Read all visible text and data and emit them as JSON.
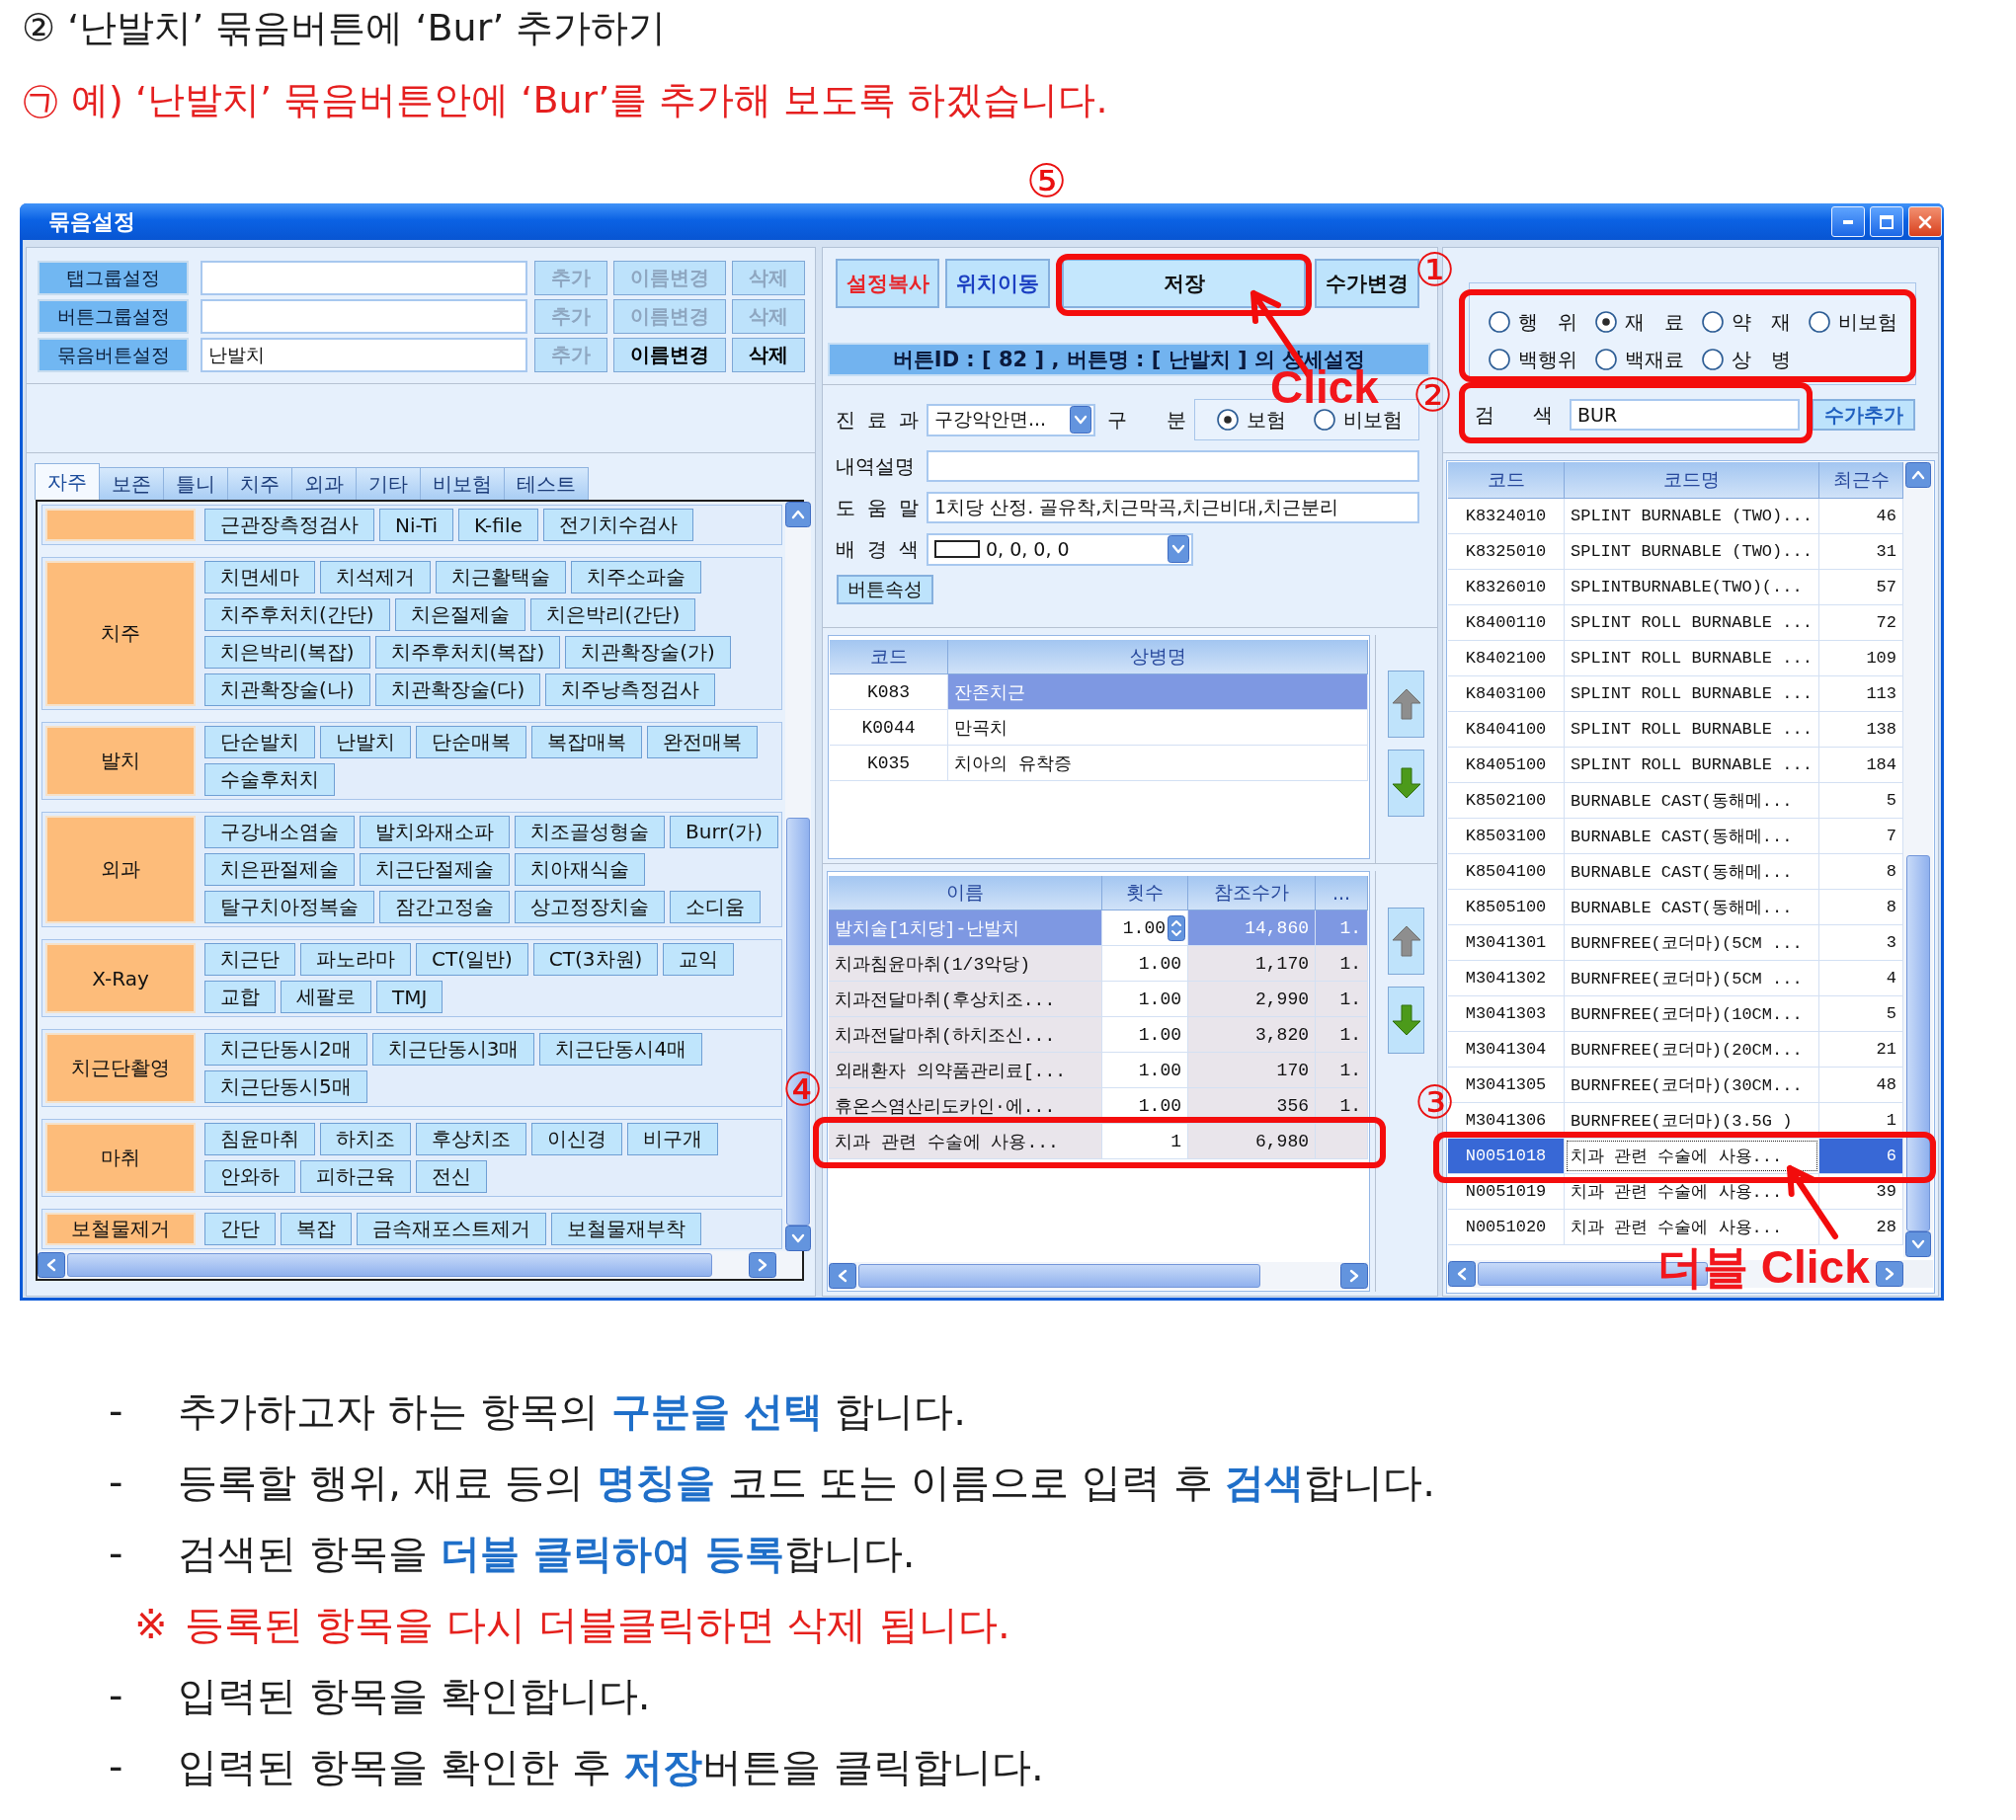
{
  "header": {
    "title": "② ‘난발치’ 묶음버튼에 ‘Bur’ 추가하기",
    "subtitle": "㉠ 예) ‘난발치’ 묶음버튼안에 ‘Bur’를 추가해 보도록 하겠습니다."
  },
  "window": {
    "title": "묶음설정"
  },
  "group_settings": [
    {
      "label": "탭그룹설정",
      "buttons": [
        {
          "label": "추가",
          "disabled": true
        },
        {
          "label": "이름변경",
          "disabled": true
        },
        {
          "label": "삭제",
          "disabled": true
        }
      ]
    },
    {
      "label": "버튼그룹설정",
      "buttons": [
        {
          "label": "추가",
          "disabled": true
        },
        {
          "label": "이름변경",
          "disabled": true
        },
        {
          "label": "삭제",
          "disabled": true
        }
      ]
    },
    {
      "label": "묶음버튼설정",
      "value": "난발치",
      "buttons": [
        {
          "label": "추가",
          "disabled": true
        },
        {
          "label": "이름변경",
          "disabled": false
        },
        {
          "label": "삭제",
          "disabled": false
        }
      ]
    }
  ],
  "tabs": [
    {
      "label": "자주",
      "selected": true
    },
    {
      "label": "보존",
      "selected": false
    },
    {
      "label": "틀니",
      "selected": false
    },
    {
      "label": "치주",
      "selected": false
    },
    {
      "label": "외과",
      "selected": false
    },
    {
      "label": "기타",
      "selected": false
    },
    {
      "label": "비보험",
      "selected": false
    },
    {
      "label": "테스트",
      "selected": false
    }
  ],
  "button_groups": [
    {
      "button_rows": [
        [
          "근관장측정검사",
          "Ni-Ti",
          "K-file",
          "전기치수검사"
        ]
      ]
    },
    {
      "label": "치주",
      "button_rows": [
        [
          "치면세마",
          "치석제거",
          "치근활택술",
          "치주소파술"
        ],
        [
          "치주후처치(간단)",
          "치은절제술",
          "치은박리(간단)"
        ],
        [
          "치은박리(복잡)",
          "치주후처치(복잡)",
          "치관확장술(가)"
        ],
        [
          "치관확장술(나)",
          "치관확장술(다)",
          "치주낭측정검사"
        ]
      ]
    },
    {
      "label": "발치",
      "button_rows": [
        [
          "단순발치",
          "난발치",
          "단순매복",
          "복잡매복",
          "완전매복"
        ],
        [
          "수술후처치"
        ]
      ]
    },
    {
      "label": "외과",
      "button_rows": [
        [
          "구강내소염술",
          "발치와재소파",
          "치조골성형술",
          "Burr(가)"
        ],
        [
          "치은판절제술",
          "치근단절제술",
          "치아재식술"
        ],
        [
          "탈구치아정복술",
          "잠간고정술",
          "상고정장치술",
          "소디움"
        ]
      ]
    },
    {
      "label": "X-Ray",
      "button_rows": [
        [
          "치근단",
          "파노라마",
          "CT(일반)",
          "CT(3차원)",
          "교익"
        ],
        [
          "교합",
          "세팔로",
          "TMJ"
        ]
      ]
    },
    {
      "label": "치근단촬영",
      "button_rows": [
        [
          "치근단동시2매",
          "치근단동시3매",
          "치근단동시4매"
        ],
        [
          "치근단동시5매"
        ]
      ]
    },
    {
      "label": "마취",
      "button_rows": [
        [
          "침윤마취",
          "하치조",
          "후상치조",
          "이신경",
          "비구개"
        ],
        [
          "안와하",
          "피하근육",
          "전신"
        ]
      ]
    },
    {
      "label": "보철물제거",
      "button_rows": [
        [
          "간단",
          "복잡",
          "금속재포스트제거",
          "보철물재부착"
        ]
      ]
    }
  ],
  "actions": [
    {
      "label": "설정복사",
      "color": "#e8262a"
    },
    {
      "label": "위치이동",
      "color": "#1b3fc2"
    },
    {
      "label": "저장",
      "color": "#111111"
    },
    {
      "label": "수가변경",
      "color": "#111111"
    }
  ],
  "detail_banner": "버튼ID : [ 82 ] , 버튼명 : [ 난발치 ] 의 상세설정",
  "form": {
    "department": {
      "label": "진 료 과",
      "value": "구강악안면..."
    },
    "category": {
      "label": "구 분",
      "options": [
        {
          "label": "보험",
          "selected": true
        },
        {
          "label": "비보험",
          "selected": false
        }
      ]
    },
    "description": {
      "label": "내역설명"
    },
    "help": {
      "label": "도 움 말",
      "value": "1치당 산정. 골유착,치근막곡,치근비대,치근분리"
    },
    "background_color": {
      "label": "배 경 색",
      "value": "0, 0, 0, 0"
    },
    "properties_button": "버튼속성"
  },
  "diagnosis_table": {
    "columns": [
      "코드",
      "상병명"
    ],
    "rows": [
      {
        "code": "K083",
        "name": "잔존치근",
        "selected": true
      },
      {
        "code": "K0044",
        "name": "만곡치",
        "selected": false
      },
      {
        "code": "K035",
        "name": "치아의 유착증",
        "selected": false
      }
    ],
    "move_buttons": [
      {
        "kind": "up",
        "disabled": true
      },
      {
        "kind": "down",
        "disabled": false
      }
    ]
  },
  "items_table": {
    "columns": [
      "이름",
      "횟수",
      "참조수가",
      "..."
    ],
    "rows": [
      {
        "name": "발치술[1치당]-난발치",
        "count": "1.00",
        "price": "14,860",
        "column_4": "1.",
        "selected": true
      },
      {
        "name": "치과침윤마취(1/3악당)",
        "count": "1.00",
        "price": "1,170",
        "column_4": "1.",
        "selected": false
      },
      {
        "name": "치과전달마취(후상치조...",
        "count": "1.00",
        "price": "2,990",
        "column_4": "1.",
        "selected": false
      },
      {
        "name": "치과전달마취(하치조신...",
        "count": "1.00",
        "price": "3,820",
        "column_4": "1.",
        "selected": false
      },
      {
        "name": "외래환자 의약품관리료[...",
        "count": "1.00",
        "price": "170",
        "column_4": "1.",
        "selected": false
      },
      {
        "name": "휴온스염산리도카인·에...",
        "count": "1.00",
        "price": "356",
        "column_4": "1.",
        "selected": false
      },
      {
        "name": "치과 관련 수술에 사용...",
        "count": "1",
        "price": "6,980",
        "selected": false
      }
    ],
    "move_buttons": [
      {
        "kind": "up",
        "disabled": true
      },
      {
        "kind": "down",
        "disabled": false
      }
    ]
  },
  "search_panel": {
    "filters": [
      {
        "label": "행 위",
        "selected": false
      },
      {
        "label": "재 료",
        "selected": true
      },
      {
        "label": "약 재",
        "selected": false
      },
      {
        "label": "비보험",
        "selected": false
      },
      {
        "label": "백행위",
        "selected": false
      },
      {
        "label": "백재료",
        "selected": false
      },
      {
        "label": "상 병",
        "selected": false
      }
    ],
    "search": {
      "label": "검 색",
      "value": "BUR"
    },
    "add_button": "수가추가"
  },
  "results_table": {
    "columns": [
      "코드",
      "코드명",
      "최근수"
    ],
    "rows": [
      {
        "code": "K8324010",
        "name": "SPLINT BURNABLE (TWO)...",
        "price": "46",
        "selected": false
      },
      {
        "code": "K8325010",
        "name": "SPLINT BURNABLE (TWO)...",
        "price": "31",
        "selected": false
      },
      {
        "code": "K8326010",
        "name": "SPLINTBURNABLE(TWO)(...",
        "price": "57",
        "selected": false
      },
      {
        "code": "K8400110",
        "name": "SPLINT ROLL BURNABLE ...",
        "price": "72",
        "selected": false
      },
      {
        "code": "K8402100",
        "name": "SPLINT ROLL BURNABLE ...",
        "price": "109",
        "selected": false
      },
      {
        "code": "K8403100",
        "name": "SPLINT ROLL BURNABLE ...",
        "price": "113",
        "selected": false
      },
      {
        "code": "K8404100",
        "name": "SPLINT ROLL BURNABLE ...",
        "price": "138",
        "selected": false
      },
      {
        "code": "K8405100",
        "name": "SPLINT ROLL BURNABLE ...",
        "price": "184",
        "selected": false
      },
      {
        "code": "K8502100",
        "name": "BURNABLE CAST(동해메...",
        "price": "5",
        "selected": false
      },
      {
        "code": "K8503100",
        "name": "BURNABLE CAST(동해메...",
        "price": "7",
        "selected": false
      },
      {
        "code": "K8504100",
        "name": "BURNABLE CAST(동해메...",
        "price": "8",
        "selected": false
      },
      {
        "code": "K8505100",
        "name": "BURNABLE CAST(동해메...",
        "price": "8",
        "selected": false
      },
      {
        "code": "M3041301",
        "name": "BURNFREE(코더마)(5CM ...",
        "price": "3",
        "selected": false
      },
      {
        "code": "M3041302",
        "name": "BURNFREE(코더마)(5CM ...",
        "price": "4",
        "selected": false
      },
      {
        "code": "M3041303",
        "name": "BURNFREE(코더마)(10CM...",
        "price": "5",
        "selected": false
      },
      {
        "code": "M3041304",
        "name": "BURNFREE(코더마)(20CM...",
        "price": "21",
        "selected": false
      },
      {
        "code": "M3041305",
        "name": "BURNFREE(코더마)(30CM...",
        "price": "48",
        "selected": false
      },
      {
        "code": "M3041306",
        "name": "BURNFREE(코더마)(3.5G )",
        "price": "1",
        "selected": false
      },
      {
        "code": "N0051018",
        "name": "치과 관련 수술에 사용...",
        "price": "6",
        "selected": true
      },
      {
        "code": "N0051019",
        "name": "치과 관련 수술에 사용...",
        "price": "39",
        "selected": false
      },
      {
        "code": "N0051020",
        "name": "치과 관련 수술에 사용...",
        "price": "28",
        "selected": false
      }
    ]
  },
  "annotations": [
    {
      "kind": "frame"
    },
    {
      "kind": "step",
      "text": "⑤"
    },
    {
      "kind": "step",
      "text": "①"
    },
    {
      "kind": "arrow"
    },
    {
      "kind": "callout",
      "text": "Click"
    },
    {
      "kind": "frame"
    },
    {
      "kind": "step",
      "text": "②"
    },
    {
      "kind": "frame"
    },
    {
      "kind": "step",
      "text": "④"
    },
    {
      "kind": "frame"
    },
    {
      "kind": "step",
      "text": "③"
    },
    {
      "kind": "frame"
    },
    {
      "kind": "arrow"
    },
    {
      "kind": "callout",
      "text": "더블 Click"
    }
  ],
  "instructions": [
    {
      "kind": "step",
      "marker": "-",
      "text": "추가하고자 하는 항목의 **구분을 선택** 합니다."
    },
    {
      "kind": "step",
      "marker": "-",
      "text": "등록할 행위, 재료 등의 **명칭을** 코드 또는 이름으로 입력 후 **검색**합니다."
    },
    {
      "kind": "step",
      "marker": "-",
      "text": "검색된 항목을 **더블 클릭하여 등록**합니다."
    },
    {
      "kind": "note",
      "marker": "※",
      "text": "등록된 항목을 다시 더블클릭하면 삭제 됩니다."
    },
    {
      "kind": "step",
      "marker": "-",
      "text": "입력된 항목을 확인합니다."
    },
    {
      "kind": "step",
      "marker": "-",
      "text": "입력된 항목을 확인한 후 **저장**버튼을 클릭합니다."
    }
  ]
}
